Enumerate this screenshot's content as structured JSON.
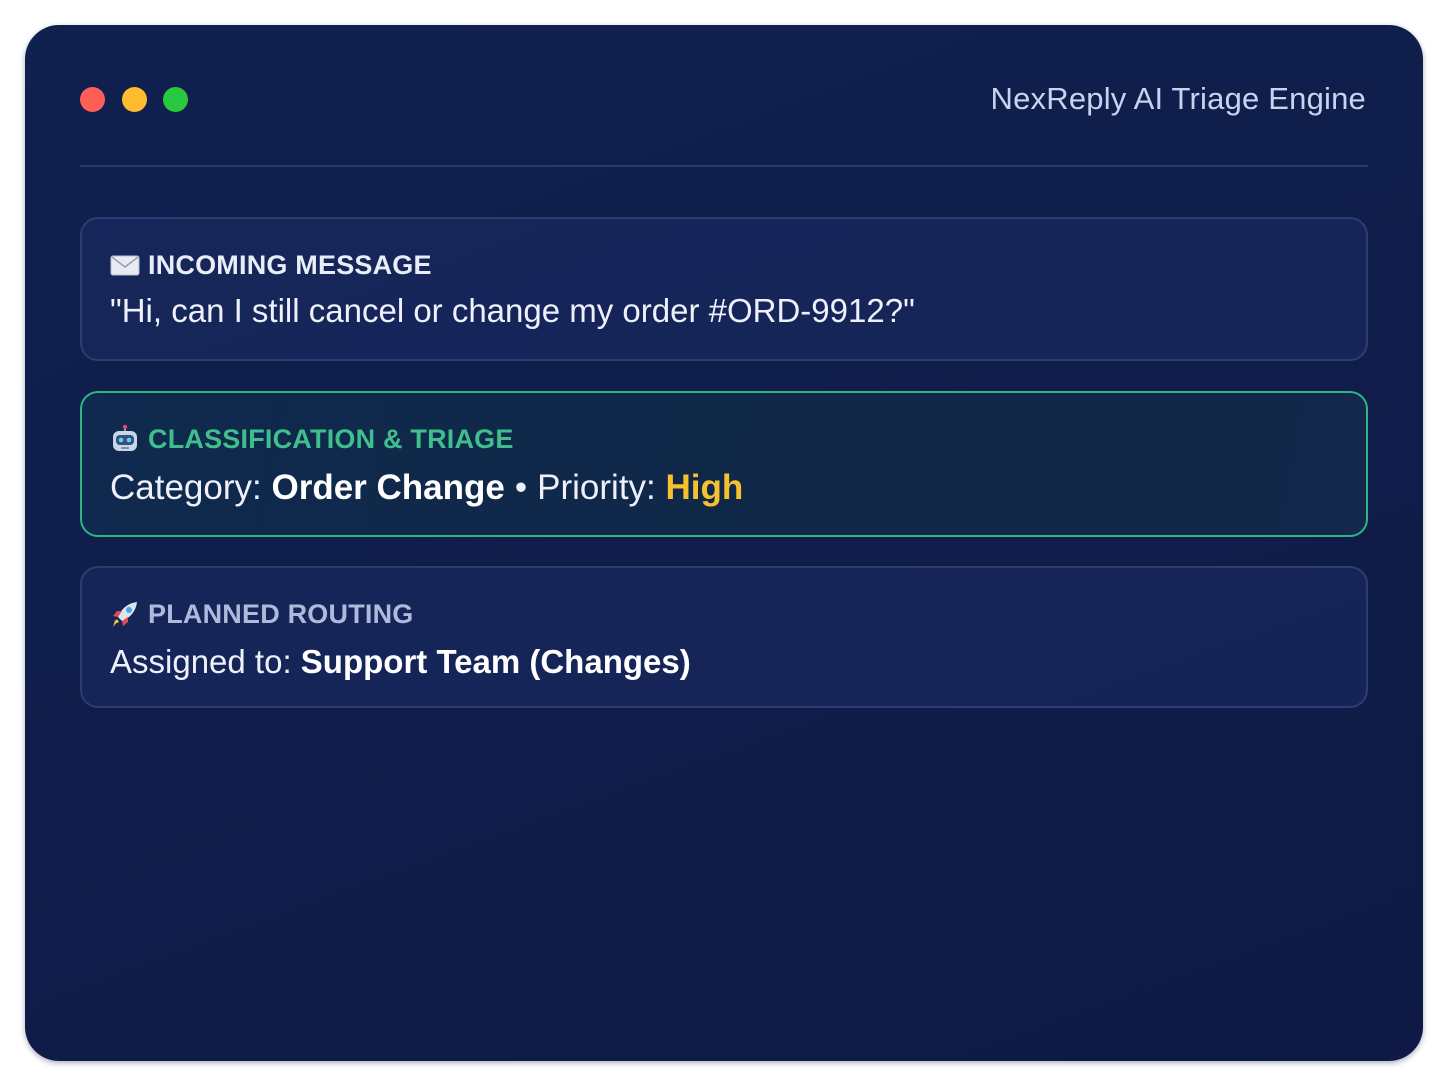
{
  "window": {
    "title": "NexReply AI Triage Engine"
  },
  "incoming": {
    "icon": "envelope-icon",
    "header": "INCOMING MESSAGE",
    "message": "\"Hi, can I still cancel or change my order #ORD-9912?\""
  },
  "classification": {
    "icon": "robot-icon",
    "header": "CLASSIFICATION & TRIAGE",
    "category_label": "Category:",
    "category_value": "Order Change",
    "separator": "•",
    "priority_label": "Priority:",
    "priority_value": "High"
  },
  "routing": {
    "icon": "rocket-icon",
    "header": "PLANNED ROUTING",
    "assigned_label": "Assigned to:",
    "assigned_value": "Support Team (Changes)"
  },
  "colors": {
    "accent_green": "#3fbf8b",
    "priority_yellow": "#f6c02e",
    "window_bg": "#10204f"
  }
}
